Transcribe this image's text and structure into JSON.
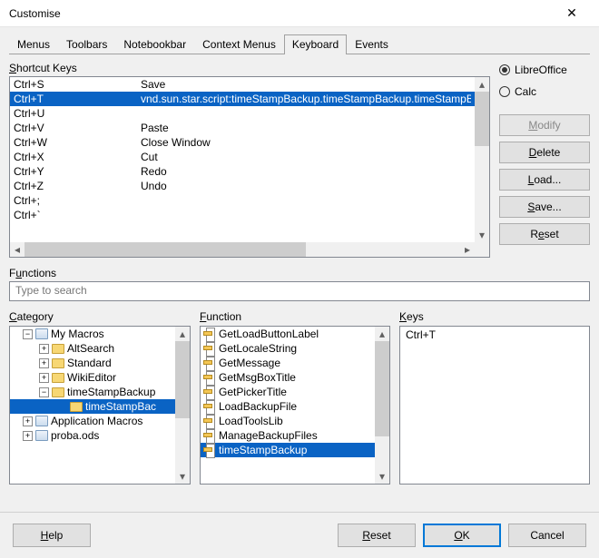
{
  "titlebar": {
    "title": "Customise"
  },
  "tabs": [
    "Menus",
    "Toolbars",
    "Notebookbar",
    "Context Menus",
    "Keyboard",
    "Events"
  ],
  "activeTab": 4,
  "shortcutLabel": "Shortcut Keys",
  "shortcuts": [
    {
      "key": "Ctrl+S",
      "fn": "Save",
      "sel": false
    },
    {
      "key": "Ctrl+T",
      "fn": "vnd.sun.star.script:timeStampBackup.timeStampBackup.timeStampBa",
      "sel": true
    },
    {
      "key": "Ctrl+U",
      "fn": "",
      "sel": false
    },
    {
      "key": "Ctrl+V",
      "fn": "Paste",
      "sel": false
    },
    {
      "key": "Ctrl+W",
      "fn": "Close Window",
      "sel": false
    },
    {
      "key": "Ctrl+X",
      "fn": "Cut",
      "sel": false
    },
    {
      "key": "Ctrl+Y",
      "fn": "Redo",
      "sel": false
    },
    {
      "key": "Ctrl+Z",
      "fn": "Undo",
      "sel": false
    },
    {
      "key": "Ctrl+;",
      "fn": "",
      "sel": false
    },
    {
      "key": "Ctrl+`",
      "fn": "",
      "sel": false
    }
  ],
  "radios": {
    "libre": "LibreOffice",
    "calc": "Calc",
    "selected": "libre"
  },
  "buttons": {
    "modify": "Modify",
    "delete": "Delete",
    "load": "Load...",
    "save": "Save...",
    "reset": "Reset",
    "help": "Help",
    "footerReset": "Reset",
    "ok": "OK",
    "cancel": "Cancel"
  },
  "functionsLabel": "Functions",
  "searchPlaceholder": "Type to search",
  "categoryLabel": "Category",
  "functionLabel": "Function",
  "keysLabel": "Keys",
  "category": [
    {
      "indent": 0,
      "exp": "-",
      "icon": "container",
      "label": "My Macros",
      "sel": false
    },
    {
      "indent": 1,
      "exp": "+",
      "icon": "folder",
      "label": "AltSearch",
      "sel": false
    },
    {
      "indent": 1,
      "exp": "+",
      "icon": "folder",
      "label": "Standard",
      "sel": false
    },
    {
      "indent": 1,
      "exp": "+",
      "icon": "folder",
      "label": "WikiEditor",
      "sel": false
    },
    {
      "indent": 1,
      "exp": "-",
      "icon": "folder",
      "label": "timeStampBackup",
      "sel": false
    },
    {
      "indent": 2,
      "exp": "",
      "icon": "folder",
      "label": "timeStampBac",
      "sel": true
    },
    {
      "indent": 0,
      "exp": "+",
      "icon": "container",
      "label": "Application Macros",
      "sel": false
    },
    {
      "indent": 0,
      "exp": "+",
      "icon": "container",
      "label": "proba.ods",
      "sel": false
    }
  ],
  "functionList": [
    {
      "label": "GetLoadButtonLabel",
      "sel": false
    },
    {
      "label": "GetLocaleString",
      "sel": false
    },
    {
      "label": "GetMessage",
      "sel": false
    },
    {
      "label": "GetMsgBoxTitle",
      "sel": false
    },
    {
      "label": "GetPickerTitle",
      "sel": false
    },
    {
      "label": "LoadBackupFile",
      "sel": false
    },
    {
      "label": "LoadToolsLib",
      "sel": false
    },
    {
      "label": "ManageBackupFiles",
      "sel": false
    },
    {
      "label": "timeStampBackup",
      "sel": true
    }
  ],
  "keysList": [
    "Ctrl+T"
  ]
}
